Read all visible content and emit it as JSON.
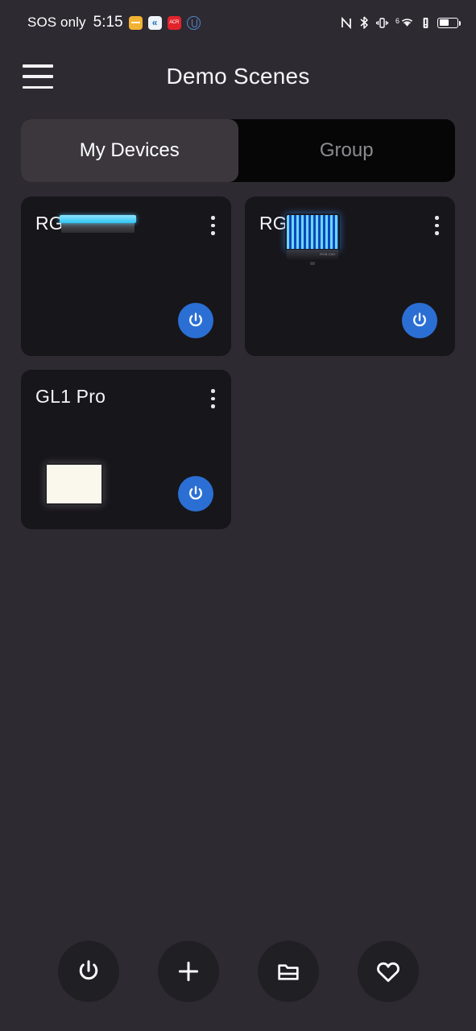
{
  "status_bar": {
    "carrier": "SOS only",
    "time": "5:15",
    "left_icons": [
      "folder-app-icon",
      "blue-app-icon",
      "acr-app-icon",
      "shield-app-icon"
    ],
    "right_icons": [
      "nfc-icon",
      "bluetooth-icon",
      "vibrate-icon",
      "wifi-icon",
      "alert-icon",
      "battery-icon"
    ],
    "wifi_generation": "6",
    "battery_level_percent": 55
  },
  "header": {
    "menu_icon": "hamburger-menu-icon",
    "title": "Demo Scenes"
  },
  "tabs": {
    "items": [
      {
        "label": "My Devices",
        "active": true
      },
      {
        "label": "Group",
        "active": false
      }
    ]
  },
  "devices": [
    {
      "name": "RGB1",
      "thumbnail": "light-bar-cyan",
      "power_icon": "power-icon",
      "menu_icon": "overflow-menu-icon"
    },
    {
      "name": "RGB C80",
      "thumbnail": "led-panel-blue",
      "power_icon": "power-icon",
      "menu_icon": "overflow-menu-icon"
    },
    {
      "name": "GL1 Pro",
      "thumbnail": "panel-warm-white",
      "power_icon": "power-icon",
      "menu_icon": "overflow-menu-icon"
    }
  ],
  "bottom_nav": {
    "items": [
      {
        "icon": "power-icon"
      },
      {
        "icon": "plus-icon"
      },
      {
        "icon": "folder-icon"
      },
      {
        "icon": "heart-icon"
      }
    ]
  },
  "colors": {
    "page_background": "#2e2a32",
    "card_background": "#17161b",
    "tab_track": "#060607",
    "tab_active": "#3b373d",
    "accent_blue": "#2b6fd4",
    "text_primary": "#f6f4f7",
    "text_muted": "#8d8a90"
  }
}
